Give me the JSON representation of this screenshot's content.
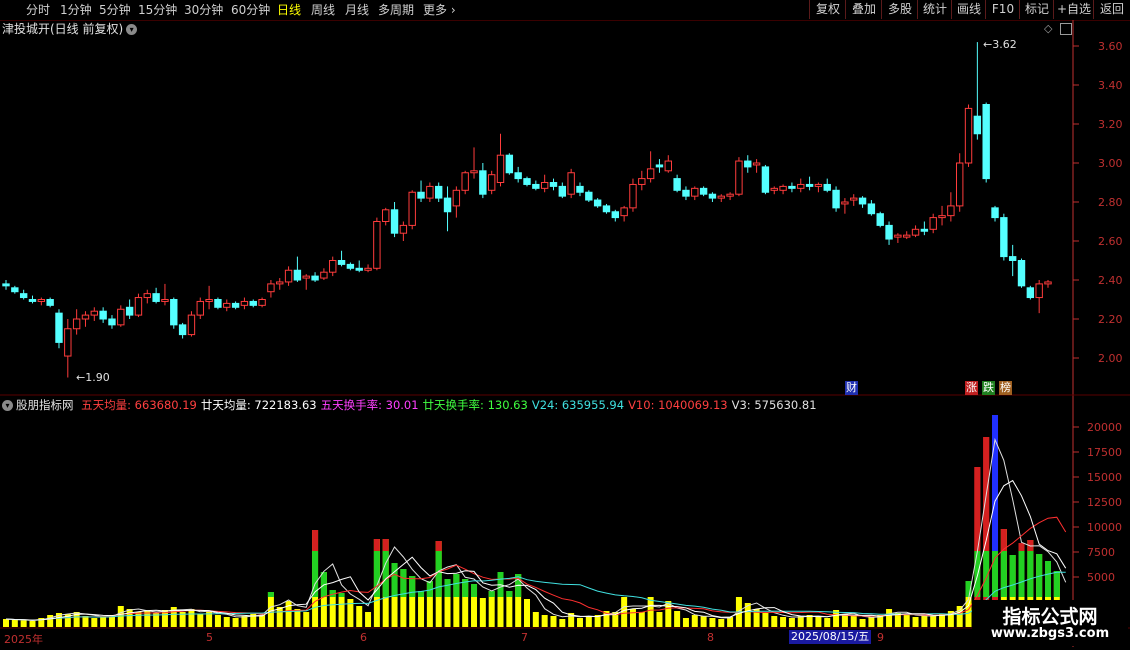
{
  "toolbar": {
    "left": [
      "分时",
      "1分钟",
      "5分钟",
      "15分钟",
      "30分钟",
      "60分钟",
      "日线",
      "周线",
      "月线",
      "多周期",
      "更多"
    ],
    "active": "日线",
    "right": [
      "复权",
      "叠加",
      "多股",
      "统计",
      "画线",
      "F10",
      "标记",
      "+自选",
      "返回"
    ]
  },
  "chart_title": "津投城开(日线 前复权)",
  "price_axis": {
    "ticks": [
      "3.60",
      "3.40",
      "3.20",
      "3.00",
      "2.80",
      "2.60",
      "2.40",
      "2.20",
      "2.00"
    ]
  },
  "price_annotations": {
    "high": "3.62",
    "low": "1.90"
  },
  "event_tags": {
    "cai": "财",
    "zhang": "涨",
    "die": "跌",
    "bang": "榜"
  },
  "indicator": {
    "name": "股朋指标网",
    "items": [
      {
        "label": "五天均量: 663680.19",
        "color": "#ff4040"
      },
      {
        "label": "廿天均量: 722183.63",
        "color": "#ffffff"
      },
      {
        "label": "五天换手率: 30.01",
        "color": "#ff40ff"
      },
      {
        "label": "廿天换手率: 130.63",
        "color": "#40ff40"
      },
      {
        "label": "V24: 635955.94",
        "color": "#40e0e0"
      },
      {
        "label": "V10: 1040069.13",
        "color": "#ff4040"
      },
      {
        "label": "V3: 575630.81",
        "color": "#e0e0e0"
      }
    ],
    "axis_ticks": [
      "20000",
      "17500",
      "15000",
      "12500",
      "10000",
      "7500",
      "5000"
    ]
  },
  "x_axis": {
    "labels": [
      "2025年",
      "5",
      "6",
      "7",
      "8",
      "9"
    ],
    "selected_date": "2025/08/15/五"
  },
  "watermark": {
    "line1": "指标公式网",
    "line2": "www.zbgs3.com"
  },
  "colors": {
    "up": "#ff3c3c",
    "down": "#54ffff",
    "grid": "#5a0000",
    "axis": "#c03030"
  },
  "chart_data": {
    "type": "candlestick",
    "y_range": [
      1.9,
      3.7
    ],
    "ohlc": [
      [
        2.38,
        2.4,
        2.35,
        2.37
      ],
      [
        2.36,
        2.37,
        2.33,
        2.34
      ],
      [
        2.33,
        2.35,
        2.3,
        2.31
      ],
      [
        2.3,
        2.32,
        2.28,
        2.29
      ],
      [
        2.29,
        2.31,
        2.27,
        2.3
      ],
      [
        2.3,
        2.31,
        2.26,
        2.27
      ],
      [
        2.23,
        2.25,
        2.05,
        2.08
      ],
      [
        2.01,
        2.2,
        1.9,
        2.15
      ],
      [
        2.15,
        2.25,
        2.12,
        2.2
      ],
      [
        2.2,
        2.24,
        2.16,
        2.22
      ],
      [
        2.22,
        2.26,
        2.19,
        2.24
      ],
      [
        2.24,
        2.26,
        2.18,
        2.2
      ],
      [
        2.2,
        2.22,
        2.15,
        2.17
      ],
      [
        2.17,
        2.27,
        2.16,
        2.25
      ],
      [
        2.26,
        2.3,
        2.2,
        2.22
      ],
      [
        2.22,
        2.33,
        2.21,
        2.31
      ],
      [
        2.31,
        2.35,
        2.28,
        2.33
      ],
      [
        2.33,
        2.36,
        2.28,
        2.29
      ],
      [
        2.29,
        2.38,
        2.27,
        2.3
      ],
      [
        2.3,
        2.31,
        2.15,
        2.17
      ],
      [
        2.17,
        2.18,
        2.1,
        2.12
      ],
      [
        2.12,
        2.24,
        2.11,
        2.22
      ],
      [
        2.22,
        2.31,
        2.2,
        2.29
      ],
      [
        2.29,
        2.37,
        2.25,
        2.3
      ],
      [
        2.3,
        2.31,
        2.25,
        2.26
      ],
      [
        2.26,
        2.3,
        2.24,
        2.28
      ],
      [
        2.28,
        2.29,
        2.25,
        2.26
      ],
      [
        2.27,
        2.31,
        2.25,
        2.29
      ],
      [
        2.29,
        2.3,
        2.26,
        2.27
      ],
      [
        2.27,
        2.31,
        2.26,
        2.3
      ],
      [
        2.34,
        2.4,
        2.31,
        2.38
      ],
      [
        2.38,
        2.41,
        2.35,
        2.39
      ],
      [
        2.39,
        2.47,
        2.37,
        2.45
      ],
      [
        2.45,
        2.52,
        2.39,
        2.4
      ],
      [
        2.41,
        2.43,
        2.35,
        2.42
      ],
      [
        2.42,
        2.44,
        2.39,
        2.4
      ],
      [
        2.41,
        2.46,
        2.4,
        2.44
      ],
      [
        2.44,
        2.52,
        2.42,
        2.5
      ],
      [
        2.5,
        2.55,
        2.47,
        2.48
      ],
      [
        2.48,
        2.49,
        2.45,
        2.46
      ],
      [
        2.46,
        2.5,
        2.44,
        2.45
      ],
      [
        2.45,
        2.48,
        2.44,
        2.46
      ],
      [
        2.46,
        2.72,
        2.45,
        2.7
      ],
      [
        2.7,
        2.77,
        2.68,
        2.76
      ],
      [
        2.76,
        2.8,
        2.62,
        2.64
      ],
      [
        2.64,
        2.7,
        2.6,
        2.68
      ],
      [
        2.68,
        2.86,
        2.66,
        2.85
      ],
      [
        2.85,
        2.91,
        2.8,
        2.82
      ],
      [
        2.82,
        2.9,
        2.8,
        2.88
      ],
      [
        2.88,
        2.9,
        2.8,
        2.82
      ],
      [
        2.82,
        2.88,
        2.65,
        2.75
      ],
      [
        2.78,
        2.88,
        2.72,
        2.86
      ],
      [
        2.86,
        2.96,
        2.84,
        2.95
      ],
      [
        2.95,
        3.08,
        2.92,
        2.96
      ],
      [
        2.96,
        3.0,
        2.82,
        2.84
      ],
      [
        2.86,
        2.96,
        2.84,
        2.94
      ],
      [
        2.9,
        3.15,
        2.88,
        3.04
      ],
      [
        3.04,
        3.05,
        2.94,
        2.95
      ],
      [
        2.95,
        2.98,
        2.9,
        2.92
      ],
      [
        2.92,
        2.93,
        2.88,
        2.89
      ],
      [
        2.89,
        2.91,
        2.86,
        2.87
      ],
      [
        2.87,
        2.94,
        2.85,
        2.9
      ],
      [
        2.9,
        2.92,
        2.86,
        2.88
      ],
      [
        2.88,
        2.9,
        2.82,
        2.83
      ],
      [
        2.84,
        2.97,
        2.82,
        2.95
      ],
      [
        2.88,
        2.9,
        2.83,
        2.85
      ],
      [
        2.85,
        2.86,
        2.8,
        2.81
      ],
      [
        2.81,
        2.82,
        2.77,
        2.78
      ],
      [
        2.78,
        2.79,
        2.74,
        2.75
      ],
      [
        2.75,
        2.76,
        2.7,
        2.72
      ],
      [
        2.73,
        2.78,
        2.7,
        2.77
      ],
      [
        2.77,
        2.92,
        2.75,
        2.89
      ],
      [
        2.89,
        2.96,
        2.86,
        2.92
      ],
      [
        2.92,
        3.06,
        2.9,
        2.97
      ],
      [
        2.99,
        3.02,
        2.95,
        2.98
      ],
      [
        2.96,
        3.04,
        2.95,
        3.01
      ],
      [
        2.92,
        2.94,
        2.85,
        2.86
      ],
      [
        2.86,
        2.88,
        2.81,
        2.83
      ],
      [
        2.83,
        2.88,
        2.81,
        2.87
      ],
      [
        2.87,
        2.88,
        2.83,
        2.84
      ],
      [
        2.84,
        2.85,
        2.8,
        2.82
      ],
      [
        2.82,
        2.84,
        2.8,
        2.83
      ],
      [
        2.83,
        2.85,
        2.81,
        2.84
      ],
      [
        2.84,
        3.03,
        2.83,
        3.01
      ],
      [
        3.01,
        3.04,
        2.95,
        2.98
      ],
      [
        2.99,
        3.02,
        2.95,
        3.0
      ],
      [
        2.98,
        2.99,
        2.84,
        2.85
      ],
      [
        2.86,
        2.88,
        2.84,
        2.87
      ],
      [
        2.86,
        2.89,
        2.84,
        2.88
      ],
      [
        2.88,
        2.9,
        2.85,
        2.87
      ],
      [
        2.87,
        2.92,
        2.85,
        2.89
      ],
      [
        2.89,
        2.93,
        2.86,
        2.88
      ],
      [
        2.88,
        2.9,
        2.85,
        2.89
      ],
      [
        2.89,
        2.92,
        2.85,
        2.86
      ],
      [
        2.86,
        2.88,
        2.75,
        2.77
      ],
      [
        2.79,
        2.82,
        2.74,
        2.8
      ],
      [
        2.81,
        2.84,
        2.78,
        2.82
      ],
      [
        2.82,
        2.83,
        2.77,
        2.79
      ],
      [
        2.79,
        2.81,
        2.73,
        2.74
      ],
      [
        2.74,
        2.75,
        2.67,
        2.68
      ],
      [
        2.68,
        2.7,
        2.58,
        2.61
      ],
      [
        2.62,
        2.64,
        2.59,
        2.63
      ],
      [
        2.62,
        2.65,
        2.61,
        2.63
      ],
      [
        2.63,
        2.68,
        2.62,
        2.66
      ],
      [
        2.66,
        2.7,
        2.63,
        2.65
      ],
      [
        2.66,
        2.74,
        2.64,
        2.72
      ],
      [
        2.72,
        2.78,
        2.68,
        2.73
      ],
      [
        2.73,
        2.85,
        2.7,
        2.78
      ],
      [
        2.78,
        3.05,
        2.75,
        3.0
      ],
      [
        3.0,
        3.3,
        2.98,
        3.28
      ],
      [
        3.24,
        3.62,
        3.12,
        3.15
      ],
      [
        3.3,
        3.31,
        2.9,
        2.92
      ],
      [
        2.77,
        2.78,
        2.7,
        2.72
      ],
      [
        2.72,
        2.74,
        2.5,
        2.52
      ],
      [
        2.52,
        2.58,
        2.42,
        2.5
      ],
      [
        2.5,
        2.51,
        2.36,
        2.37
      ],
      [
        2.36,
        2.37,
        2.3,
        2.31
      ],
      [
        2.31,
        2.4,
        2.23,
        2.38
      ],
      [
        2.38,
        2.4,
        2.36,
        2.39
      ]
    ],
    "volume": [
      800,
      700,
      650,
      600,
      900,
      1200,
      1400,
      1300,
      1500,
      1100,
      900,
      1000,
      1200,
      2100,
      1800,
      1500,
      1600,
      1400,
      1700,
      2000,
      1500,
      1800,
      1300,
      1600,
      1200,
      1000,
      900,
      1100,
      1300,
      1200,
      3500,
      2000,
      2600,
      1800,
      1500,
      9700,
      5500,
      3700,
      3400,
      2800,
      2100,
      1500,
      8800,
      8800,
      6400,
      5800,
      5100,
      3600,
      4600,
      8600,
      4800,
      5300,
      4800,
      4300,
      2900,
      3600,
      5500,
      3600,
      5300,
      2800,
      1500,
      1200,
      1100,
      800,
      1400,
      900,
      1000,
      1200,
      1600,
      1500,
      3000,
      1800,
      1500,
      3000,
      1500,
      2600,
      1600,
      900,
      1200,
      1100,
      900,
      800,
      1000,
      3000,
      2400,
      1800,
      1400,
      1100,
      1000,
      900,
      1100,
      1200,
      1000,
      900,
      1700,
      1300,
      1100,
      800,
      1000,
      1200,
      1800,
      1400,
      1200,
      1000,
      1200,
      1100,
      1300,
      1600,
      2100,
      4600,
      16000,
      19000,
      21200,
      9800,
      7200,
      8400,
      8700,
      7300,
      6600,
      5600,
      1200
    ]
  }
}
